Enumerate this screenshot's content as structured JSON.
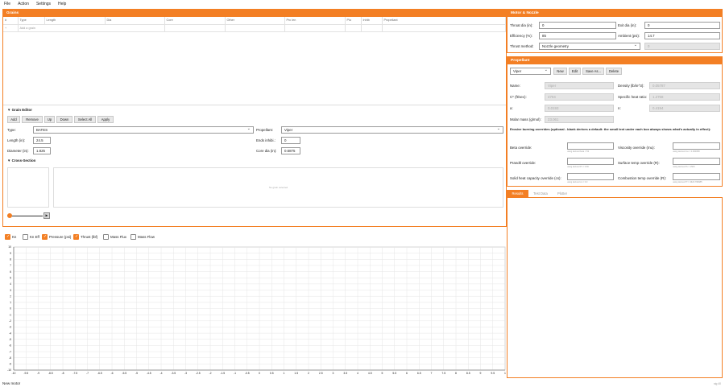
{
  "menu": [
    "File",
    "Action",
    "Settings",
    "Help"
  ],
  "grains": {
    "title": "Grains",
    "columns": [
      "#",
      "Type",
      "Length",
      "Dia",
      "Core",
      "Other",
      "Prc len",
      "Plo",
      "Inhib",
      "Propellant"
    ],
    "add_row": {
      "marker": "+",
      "placeholder": "Add a grain"
    }
  },
  "grain_editor": {
    "title": "▼ Grain Editor",
    "buttons": [
      "Add",
      "Remove",
      "Up",
      "Down",
      "Select All",
      "Apply"
    ],
    "type_label": "Type:",
    "type_value": "BATES",
    "propellant_label": "Propellant:",
    "propellant_value": "Viper",
    "length_label": "Length (in):",
    "length_value": "24.5",
    "ends_label": "Ends inhibi.:",
    "ends_value": "0",
    "diameter_label": "Diameter (in):",
    "diameter_value": "1.825",
    "core_label": "Core dia (in):",
    "core_value": "0.6875"
  },
  "cross_section": {
    "title": "▼ Cross-Section",
    "empty_text": "No grain selected",
    "play_icon": "▶"
  },
  "chart_toggles": [
    {
      "label": "Kn",
      "checked": true
    },
    {
      "label": "Kn Eff",
      "checked": false
    },
    {
      "label": "Pressure (psi)",
      "checked": true
    },
    {
      "label": "Thrust (lbf)",
      "checked": true
    },
    {
      "label": "Mass Flux",
      "checked": false
    },
    {
      "label": "Mass Flow",
      "checked": false
    }
  ],
  "chart_data": {
    "type": "line",
    "series": [],
    "xlim": [
      -1,
      1
    ],
    "ylim": [
      -10,
      10
    ],
    "x_ticks": [
      "-10",
      "-9.5",
      "-9",
      "-8.5",
      "-8",
      "-7.5",
      "-7",
      "-6.5",
      "-6",
      "-5.5",
      "-5",
      "-4.5",
      "-4",
      "-3.5",
      "-3",
      "-2.5",
      "-2",
      "-1.5",
      "-1",
      "-0.5",
      "0",
      "0.5",
      "1",
      "1.5",
      "2",
      "2.5",
      "3",
      "3.5",
      "4",
      "4.5",
      "5",
      "5.5",
      "6",
      "6.5",
      "7",
      "7.5",
      "8",
      "8.5",
      "9",
      "9.5",
      "1"
    ],
    "y_ticks": [
      "10",
      "9",
      "8",
      "7",
      "6",
      "5",
      "4",
      "3",
      "2",
      "1",
      "0",
      "-1",
      "-2",
      "-3",
      "-4",
      "-5",
      "-6",
      "-7",
      "-8",
      "-9",
      "-10"
    ],
    "grid": true
  },
  "motor_nozzle": {
    "title": "Motor & Nozzle",
    "throat_label": "Throat dia (in):",
    "throat_value": "0",
    "exit_label": "Exit dia (in):",
    "exit_value": "0",
    "eff_label": "Efficiency (%):",
    "eff_value": "85",
    "ambient_label": "Ambient (psi):",
    "ambient_value": "14.7",
    "method_label": "Thrust method:",
    "method_value": "Nozzle geometry",
    "cf_value": "0"
  },
  "propellant": {
    "title": "Propellant",
    "select_value": "Viper",
    "buttons": [
      "New",
      "Edit",
      "Save As...",
      "Delete"
    ],
    "name_label": "Name:",
    "name_value": "Viper",
    "density_label": "Density (lb/in^3):",
    "density_value": "0.05787",
    "cstar_label": "C* (ft/sec):",
    "cstar_value": "4704",
    "gamma_label": "Specific heat ratio:",
    "gamma_value": "1.2758",
    "a_label": "a:",
    "a_value": "0.0193",
    "n_label": "n:",
    "n_value": "0.4194",
    "molar_label": "Molar mass (g/mol):",
    "molar_value": "23.061",
    "erosive_note": "Erosive burning overrides (optional - blank derives a default: the small text under each box always shows what's actually in effect):",
    "beta_label": "Beta override:",
    "beta_hint": "using derived beta = 53",
    "visc_label": "Viscosity override (mu):",
    "visc_hint": "using derived mu = 0.000058",
    "prandtl_label": "Prandtl override:",
    "prandtl_hint": "using derived Pr = 0.69",
    "surf_label": "Surface temp override (R):",
    "surf_hint": "using derived Ts = 1500",
    "cp_label": "Solid heat capacity override (cs):",
    "cp_hint": "using derived cs = 0.3",
    "comb_label": "Combustion temp override (R):",
    "comb_hint": "using derived Tf = 4620.798485"
  },
  "results_tabs": [
    {
      "label": "Results",
      "active": true
    },
    {
      "label": "Test Data",
      "active": false
    },
    {
      "label": "Plotter",
      "active": false
    }
  ],
  "status": {
    "left": "New motor",
    "right": "sig 40"
  },
  "colors": {
    "accent": "#f37f24"
  }
}
